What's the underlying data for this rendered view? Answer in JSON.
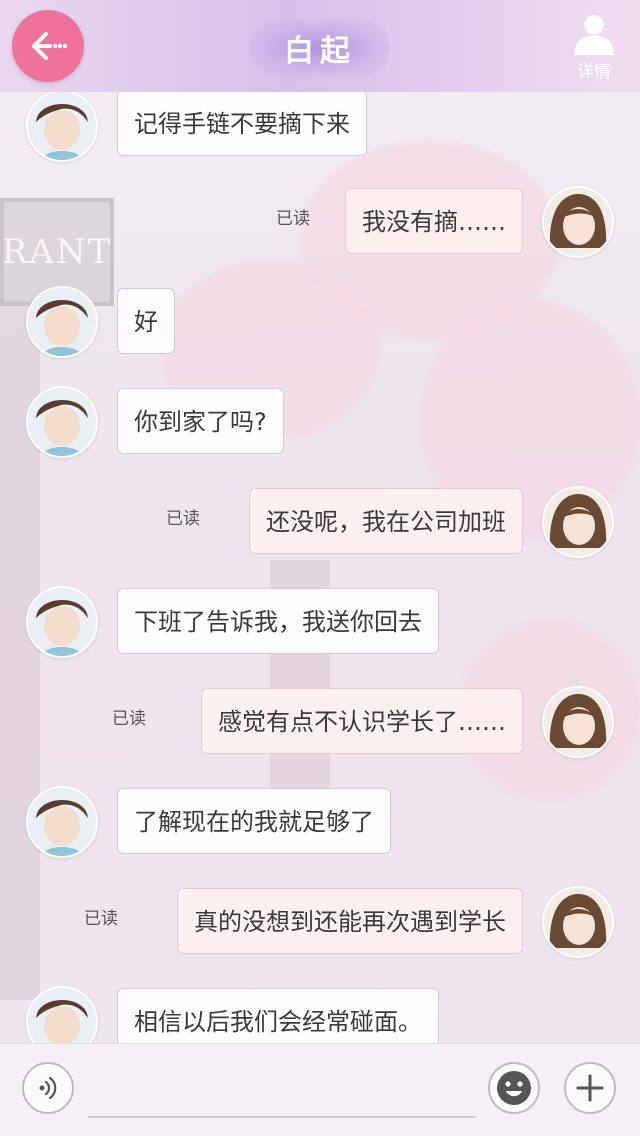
{
  "header": {
    "title": "白起",
    "detail_label": "详情",
    "back_color": "#f0729a"
  },
  "background": {
    "sign_text": "RANT"
  },
  "messages": [
    {
      "side": "left",
      "text": "记得手链不要摘下来",
      "read_label": ""
    },
    {
      "side": "right",
      "text": "我没有摘……",
      "read_label": "已读"
    },
    {
      "side": "left",
      "text": "好",
      "read_label": ""
    },
    {
      "side": "left",
      "text": "你到家了吗?",
      "read_label": ""
    },
    {
      "side": "right",
      "text": "还没呢，我在公司加班",
      "read_label": "已读"
    },
    {
      "side": "left",
      "text": "下班了告诉我，我送你回去",
      "read_label": ""
    },
    {
      "side": "right",
      "text": "感觉有点不认识学长了……",
      "read_label": "已读"
    },
    {
      "side": "left",
      "text": "了解现在的我就足够了",
      "read_label": ""
    },
    {
      "side": "right",
      "text": "真的没想到还能再次遇到学长",
      "read_label": "已读"
    },
    {
      "side": "left",
      "text": "相信以后我们会经常碰面。",
      "read_label": ""
    }
  ],
  "input": {
    "placeholder": "",
    "voice_icon": "voice-icon",
    "emoji_icon": "emoji-icon",
    "plus_icon": "plus-icon"
  }
}
